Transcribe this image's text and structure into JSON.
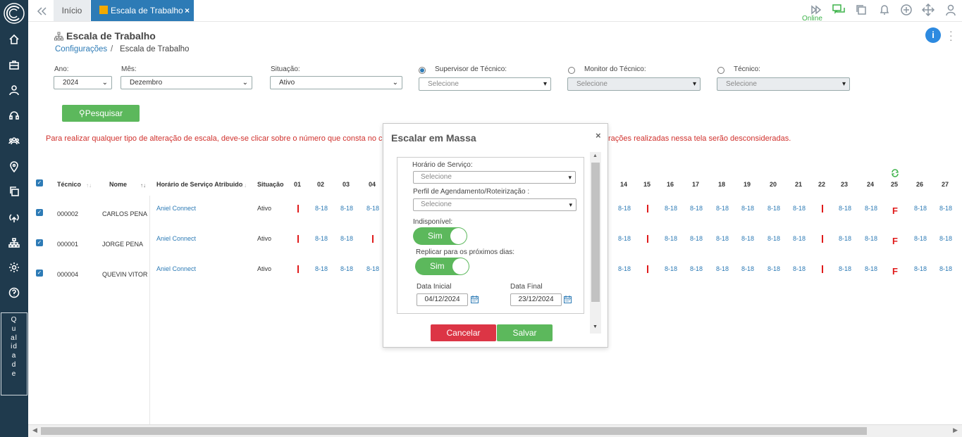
{
  "colors": {
    "sidebar": "#1f3a4d",
    "accent": "#2d7bb6",
    "success": "#5cb85c",
    "danger": "#dc3545",
    "warning_text": "#d0312d"
  },
  "sidebar": {
    "icons": [
      "logo-icon",
      "home-icon",
      "briefcase-icon",
      "user-icon",
      "headset-icon",
      "team-icon",
      "location-icon",
      "copy-icon",
      "antenna-icon",
      "hierarchy-icon",
      "settings-icon",
      "help-icon"
    ],
    "quality_label": "Qualidade"
  },
  "tabs": {
    "home": "Início",
    "current": "Escala de Trabalho",
    "close": "×"
  },
  "topbar": {
    "status": "Online"
  },
  "header": {
    "title": "Escala de Trabalho",
    "breadcrumb_link": "Configurações",
    "breadcrumb_sep": "/",
    "breadcrumb_current": "Escala de Trabalho",
    "info": "i"
  },
  "filters": {
    "year_label": "Ano:",
    "year_value": "2024",
    "month_label": "Mês:",
    "month_value": "Dezembro",
    "status_label": "Situação:",
    "status_value": "Ativo",
    "supervisor_label": "Supervisor de Técnico:",
    "supervisor_value": "Selecione",
    "monitor_label": "Monitor do Técnico:",
    "monitor_value": "Selecione",
    "tech_label": "Técnico:",
    "tech_value": "Selecione",
    "search_label": "Pesquisar"
  },
  "warning": {
    "left": "Para realizar qualquer tipo de alteração de escala, deve-se clicar sobre o número que consta no c",
    "right": "rações realizadas nessa tela serão desconsideradas."
  },
  "table": {
    "headers": {
      "tech": "Técnico",
      "name": "Nome",
      "schedule": "Horário de Serviço Atribuido",
      "status": "Situação"
    },
    "days_left": [
      "01",
      "02",
      "03",
      "04"
    ],
    "days_right": [
      "14",
      "15",
      "16",
      "17",
      "18",
      "19",
      "20",
      "21",
      "22",
      "23",
      "24",
      "25",
      "26",
      "27"
    ],
    "rows": [
      {
        "code": "000002",
        "name": "CARLOS PENA",
        "schedule": "Aniel Connect",
        "status": "Ativo",
        "left": [
          "I",
          "8-18",
          "8-18",
          "8-18"
        ],
        "right": [
          "8-18",
          "I",
          "8-18",
          "8-18",
          "8-18",
          "8-18",
          "8-18",
          "8-18",
          "I",
          "8-18",
          "8-18",
          "F",
          "8-18",
          "8-18"
        ]
      },
      {
        "code": "000001",
        "name": "JORGE PENA",
        "schedule": "Aniel Connect",
        "status": "Ativo",
        "left": [
          "I",
          "8-18",
          "8-18",
          "I"
        ],
        "right": [
          "8-18",
          "I",
          "8-18",
          "8-18",
          "8-18",
          "8-18",
          "8-18",
          "8-18",
          "I",
          "8-18",
          "8-18",
          "F",
          "8-18",
          "8-18"
        ]
      },
      {
        "code": "000004",
        "name": "QUEVIN VITOR",
        "schedule": "Aniel Connect",
        "status": "Ativo",
        "left": [
          "I",
          "8-18",
          "8-18",
          "8-18"
        ],
        "right": [
          "8-18",
          "I",
          "8-18",
          "8-18",
          "8-18",
          "8-18",
          "8-18",
          "8-18",
          "I",
          "8-18",
          "8-18",
          "F",
          "8-18",
          "8-18"
        ]
      }
    ]
  },
  "modal": {
    "title": "Escalar em Massa",
    "close": "×",
    "service_label": "Horário de Serviço:",
    "service_value": "Selecione",
    "profile_label": "Perfil de Agendamento/Roteirização :",
    "profile_value": "Selecione",
    "unavailable_label": "Indisponível:",
    "unavailable_value": "Sim",
    "replicate_label": "Replicar para os próximos dias:",
    "replicate_value": "Sim",
    "start_label": "Data Inicial",
    "start_value": "04/12/2024",
    "end_label": "Data Final",
    "end_value": "23/12/2024",
    "cancel": "Cancelar",
    "save": "Salvar"
  }
}
